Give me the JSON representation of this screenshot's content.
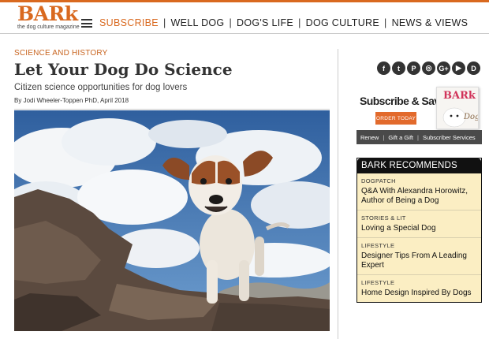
{
  "header": {
    "logo_word": "BARk",
    "logo_tagline": "the dog culture magazine",
    "nav": [
      {
        "label": "SUBSCRIBE",
        "active": true
      },
      {
        "label": "WELL DOG",
        "active": false
      },
      {
        "label": "DOG'S LIFE",
        "active": false
      },
      {
        "label": "DOG CULTURE",
        "active": false
      },
      {
        "label": "NEWS & VIEWS",
        "active": false
      }
    ],
    "nav_separator": "|"
  },
  "article": {
    "kicker": "SCIENCE AND HISTORY",
    "title": "Let Your Dog Do Science",
    "deck": "Citizen science opportunities for dog lovers",
    "byline_prefix": "By",
    "author": "Jodi Wheeler-Toppen",
    "byline_suffix": "PhD, April 2018"
  },
  "social": [
    {
      "icon": "facebook-icon",
      "glyph": "f"
    },
    {
      "icon": "twitter-icon",
      "glyph": "t"
    },
    {
      "icon": "pinterest-icon",
      "glyph": "P"
    },
    {
      "icon": "instagram-icon",
      "glyph": "◎"
    },
    {
      "icon": "googleplus-icon",
      "glyph": "G+"
    },
    {
      "icon": "youtube-icon",
      "glyph": "▶"
    },
    {
      "icon": "disqus-icon",
      "glyph": "D"
    }
  ],
  "subscribe": {
    "title": "Subscribe & Save",
    "order_button": "ORDER TODAY",
    "magazine_logo": "BARk",
    "magazine_cover_word": "Dog",
    "links": [
      "Renew",
      "Gift a Gift",
      "Subscriber Services"
    ]
  },
  "recommends": {
    "heading": "BARK RECOMMENDS",
    "items": [
      {
        "category": "DOGPATCH",
        "title": "Q&A With Alexandra Horowitz, Author of Being a Dog"
      },
      {
        "category": "STORIES & LIT",
        "title": "Loving a Special Dog"
      },
      {
        "category": "LIFESTYLE",
        "title": "Designer Tips From A Leading Expert"
      },
      {
        "category": "LIFESTYLE",
        "title": "Home Design Inspired By Dogs"
      }
    ]
  },
  "colors": {
    "brand": "#d9691f",
    "order_button": "#e26a2c",
    "recommend_bg": "#fbeec3",
    "sky": "#3b6fb0"
  }
}
